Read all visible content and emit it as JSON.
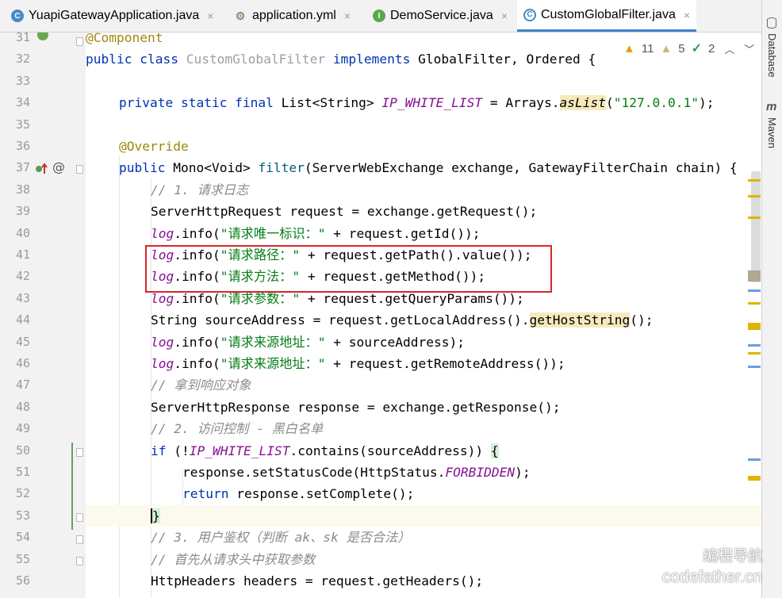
{
  "tabs": [
    {
      "label": "YuapiGatewayApplication.java",
      "icon": "spring-class-icon",
      "active": false
    },
    {
      "label": "application.yml",
      "icon": "yaml-file-icon",
      "active": false
    },
    {
      "label": "DemoService.java",
      "icon": "interface-icon",
      "active": false
    },
    {
      "label": "CustomGlobalFilter.java",
      "icon": "class-icon",
      "active": true
    }
  ],
  "tab_close": "×",
  "side_panels": {
    "database": "Database",
    "maven": "Maven"
  },
  "inspections": {
    "warnings": "11",
    "weak_warnings": "5",
    "typos": "2"
  },
  "line_numbers": [
    "31",
    "32",
    "33",
    "34",
    "35",
    "36",
    "37",
    "38",
    "39",
    "40",
    "41",
    "42",
    "43",
    "44",
    "45",
    "46",
    "47",
    "48",
    "49",
    "50",
    "51",
    "52",
    "53",
    "54",
    "55",
    "56"
  ],
  "code": {
    "l31": [
      "@Component"
    ],
    "l32": [
      "public class ",
      "CustomGlobalFilter",
      " implements ",
      "GlobalFilter, Ordered {"
    ],
    "l34": [
      "private static final ",
      "List<String> ",
      "IP_WHITE_LIST",
      " = Arrays.",
      "asList",
      "(",
      "\"127.0.0.1\"",
      ");"
    ],
    "l36": [
      "@Override"
    ],
    "l37": [
      "public ",
      "Mono<Void> ",
      "filter",
      "(ServerWebExchange exchange, GatewayFilterChain chain) {"
    ],
    "l38": [
      "// 1. 请求日志"
    ],
    "l39": [
      "ServerHttpRequest request = exchange.getRequest();"
    ],
    "l40": [
      "log",
      ".info(",
      "\"请求唯一标识：\"",
      " + request.getId());"
    ],
    "l41": [
      "log",
      ".info(",
      "\"请求路径：\"",
      " + request.getPath().value());"
    ],
    "l42": [
      "log",
      ".info(",
      "\"请求方法：\"",
      " + request.getMethod());"
    ],
    "l43": [
      "log",
      ".info(",
      "\"请求参数：\"",
      " + request.getQueryParams());"
    ],
    "l44": [
      "String sourceAddress = request.getLocalAddress().",
      "getHostString",
      "();"
    ],
    "l45": [
      "log",
      ".info(",
      "\"请求来源地址：\"",
      " + sourceAddress);"
    ],
    "l46": [
      "log",
      ".info(",
      "\"请求来源地址：\"",
      " + request.getRemoteAddress());"
    ],
    "l47": [
      "// 拿到响应对象"
    ],
    "l48": [
      "ServerHttpResponse response = exchange.getResponse();"
    ],
    "l49": [
      "// 2. 访问控制 - 黑白名单"
    ],
    "l50": [
      "if ",
      "(!",
      "IP_WHITE_LIST",
      ".contains(sourceAddress)) ",
      "{"
    ],
    "l51": [
      "response.setStatusCode(HttpStatus.",
      "FORBIDDEN",
      ");"
    ],
    "l52": [
      "return ",
      "response.setComplete();"
    ],
    "l53": [
      "}"
    ],
    "l54": [
      "// 3. 用户鉴权（判断 ak、sk 是否合法）"
    ],
    "l55": [
      "// 首先从请求头中获取参数"
    ],
    "l56": [
      "HttpHeaders headers = request.getHeaders();"
    ]
  },
  "watermark": {
    "line1": "编程导航",
    "line2": "codefather.cn"
  },
  "colors": {
    "keyword": "#0033b3",
    "string": "#067d17",
    "static_field": "#871094",
    "comment": "#8c8c8c",
    "annotation": "#9e880d",
    "highlight_box": "#d8262b",
    "active_tab_underline": "#4083c9"
  }
}
